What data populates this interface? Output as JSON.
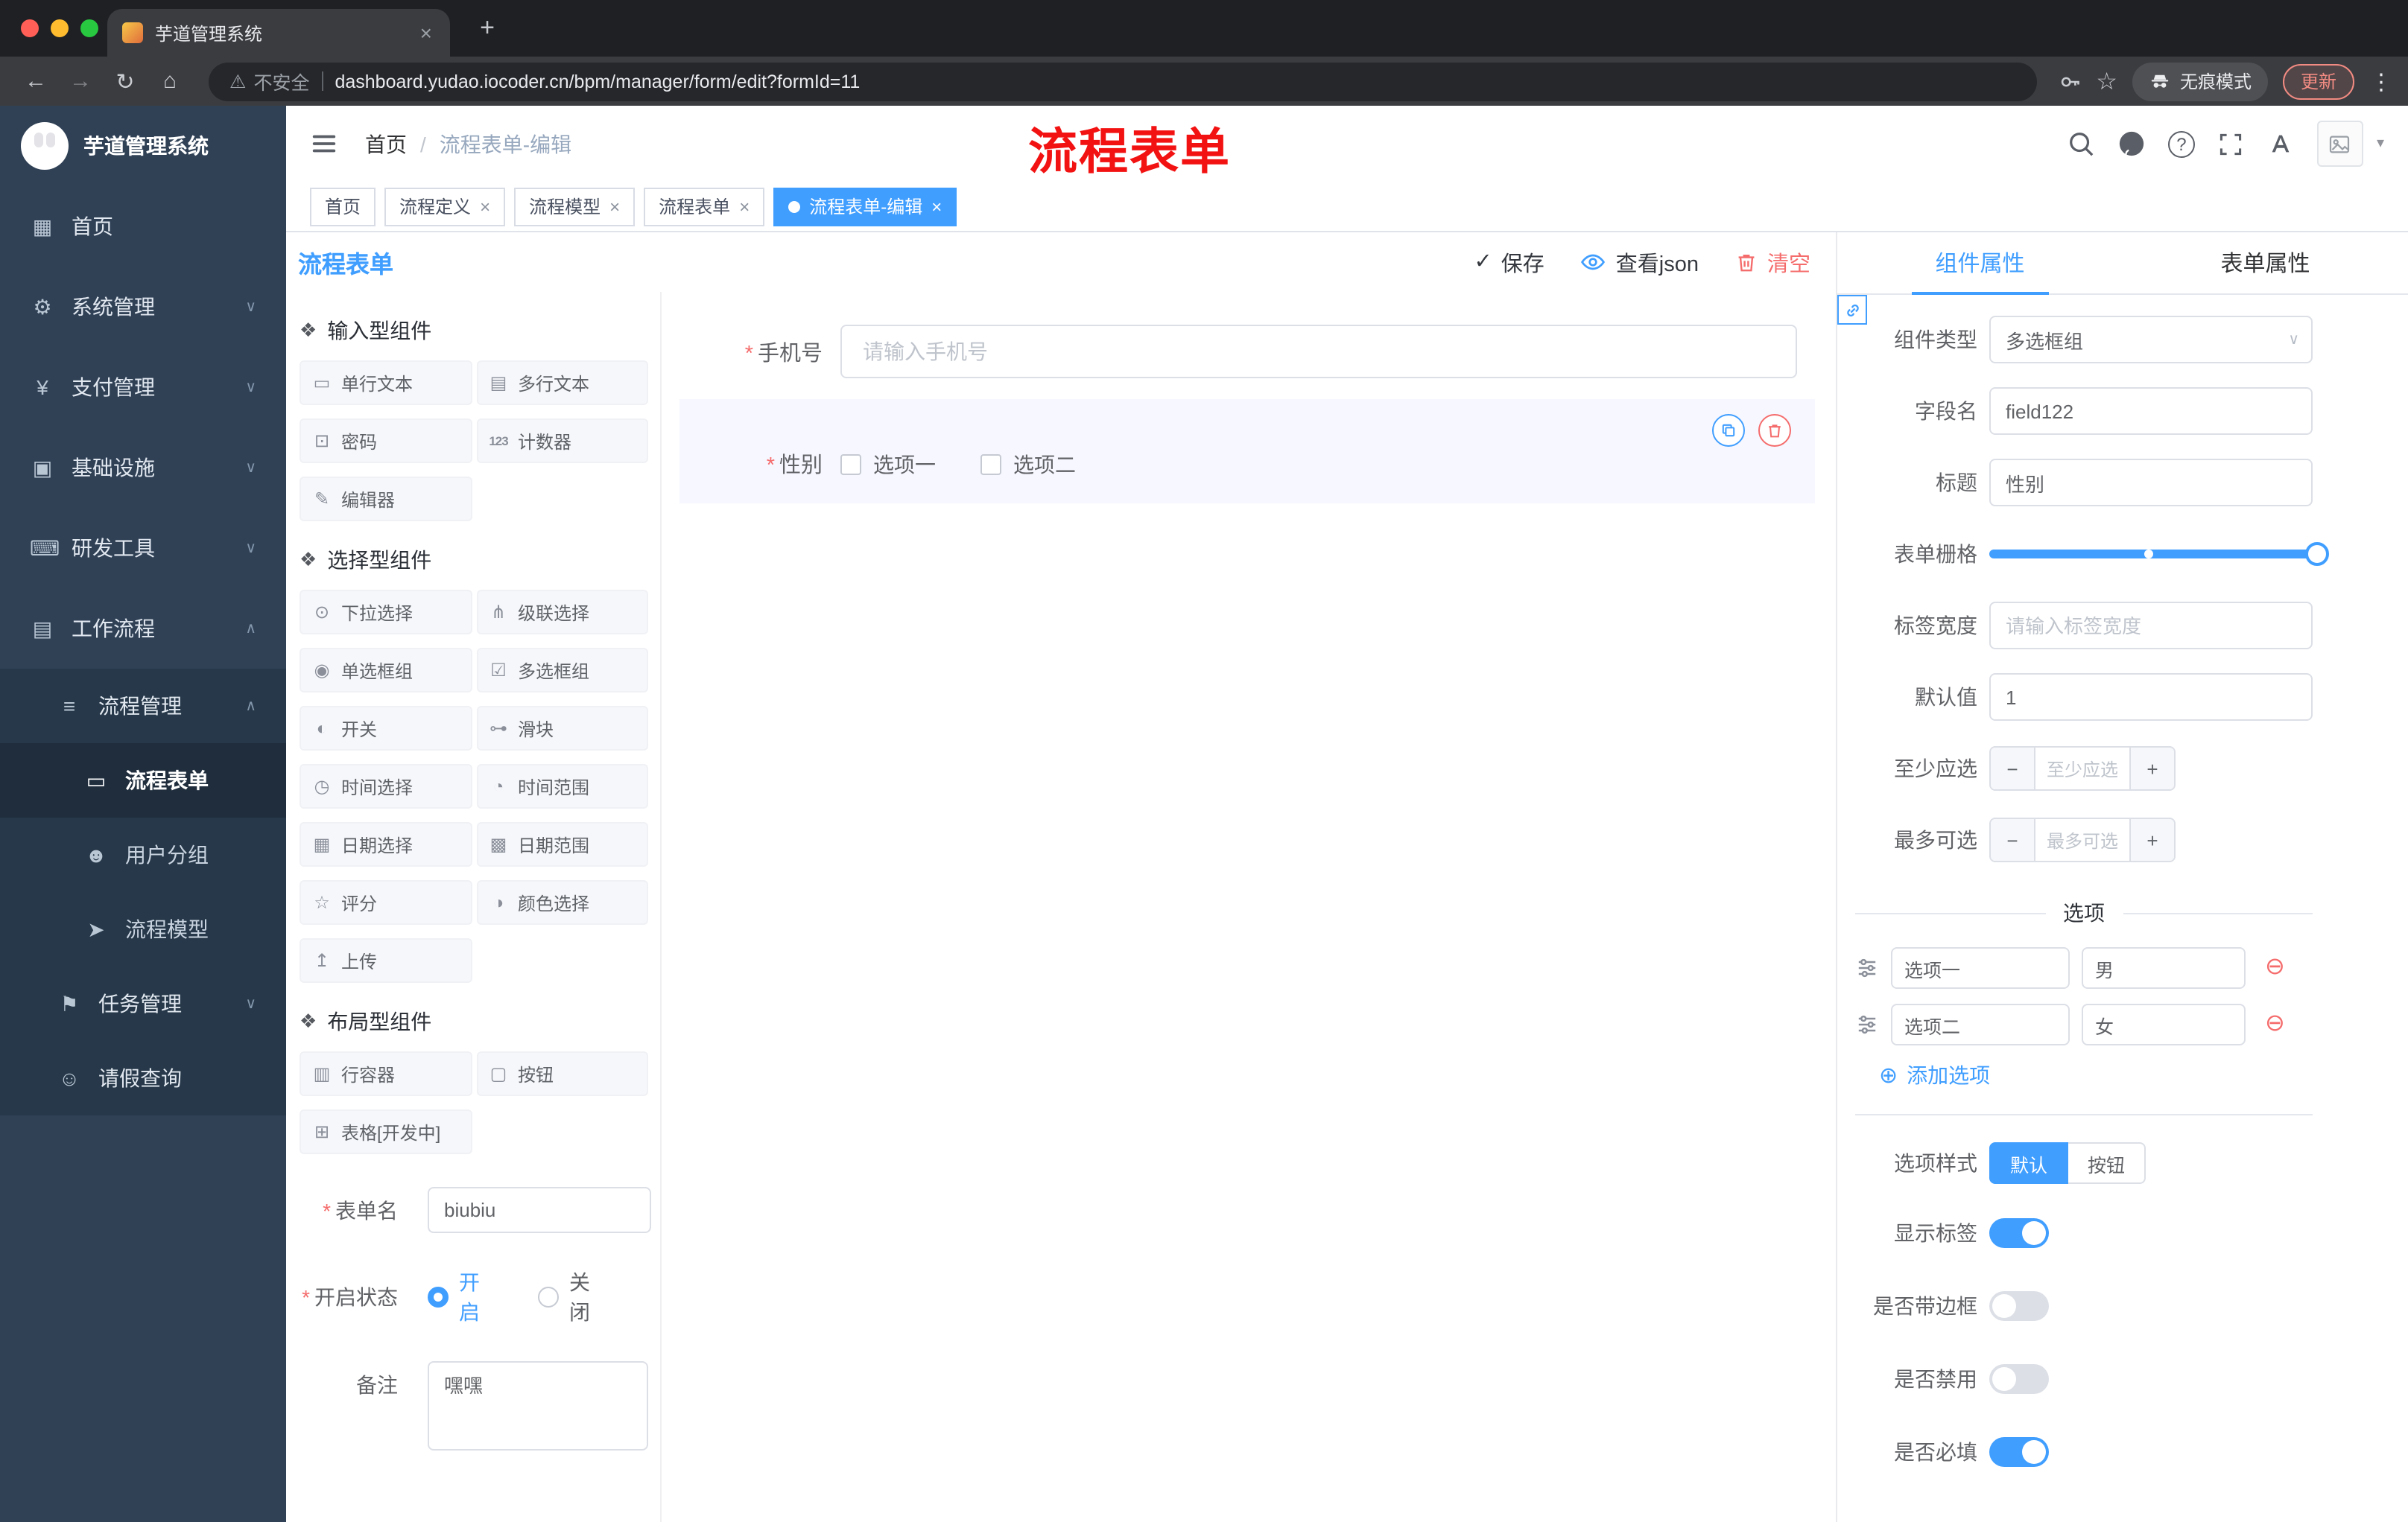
{
  "icons": {
    "back": "←",
    "forward": "→",
    "reload": "↻",
    "home": "⌂",
    "warning": "⚠",
    "pipe": "|",
    "star": "☆",
    "kebab": "⋮",
    "plus": "+",
    "close": "×",
    "question": "?",
    "caret": "▾",
    "check": "✓",
    "minus_circle": "⊖",
    "plus_circle": "⊕",
    "chevron_down": "∨",
    "chevron_up": "∧",
    "asterisk": "*",
    "section": "❖",
    "minus": "−"
  },
  "colors": {
    "primary": "#409eff",
    "danger": "#f56c6c",
    "active_tag": "#409eff"
  },
  "browser": {
    "tab_title": "芋道管理系统",
    "security_label": "不安全",
    "url": "dashboard.yudao.iocoder.cn/bpm/manager/form/edit?formId=11",
    "incognito_label": "无痕模式",
    "update_label": "更新"
  },
  "sidebar": {
    "logo_title": "芋道管理系统",
    "top_items": [
      {
        "label": "首页",
        "icon": "▦",
        "chevron": ""
      },
      {
        "label": "系统管理",
        "icon": "⚙",
        "chevron": "∨"
      },
      {
        "label": "支付管理",
        "icon": "¥",
        "chevron": "∨"
      },
      {
        "label": "基础设施",
        "icon": "▣",
        "chevron": "∨"
      },
      {
        "label": "研发工具",
        "icon": "⌨",
        "chevron": "∨"
      },
      {
        "label": "工作流程",
        "icon": "▤",
        "chevron": "∧"
      }
    ],
    "sub": {
      "manage": {
        "label": "流程管理",
        "icon": "≡",
        "chevron": "∧"
      },
      "leaves": [
        {
          "label": "流程表单",
          "icon": "▭",
          "active": true
        },
        {
          "label": "用户分组",
          "icon": "☻",
          "active": false
        },
        {
          "label": "流程模型",
          "icon": "➤",
          "active": false
        }
      ],
      "task": {
        "label": "任务管理",
        "icon": "⚑",
        "chevron": "∨"
      },
      "leave": {
        "label": "请假查询",
        "icon": "☺"
      }
    }
  },
  "header": {
    "breadcrumb": [
      "首页",
      "流程表单-编辑"
    ],
    "annotation": "流程表单"
  },
  "tags": [
    {
      "label": "首页",
      "closable": false,
      "active": false
    },
    {
      "label": "流程定义",
      "closable": true,
      "active": false
    },
    {
      "label": "流程模型",
      "closable": true,
      "active": false
    },
    {
      "label": "流程表单",
      "closable": true,
      "active": false
    },
    {
      "label": "流程表单-编辑",
      "closable": true,
      "active": true
    }
  ],
  "designer": {
    "title": "流程表单",
    "toolbar": {
      "save": "保存",
      "view_json": "查看json",
      "clear": "清空"
    },
    "palette": {
      "sections": [
        {
          "title": "输入型组件",
          "items": [
            {
              "label": "单行文本",
              "icon": "▭"
            },
            {
              "label": "多行文本",
              "icon": "▤"
            },
            {
              "label": "密码",
              "icon": "⊡"
            },
            {
              "label": "计数器",
              "icon": "123"
            },
            {
              "label": "编辑器",
              "icon": "✎"
            }
          ]
        },
        {
          "title": "选择型组件",
          "items": [
            {
              "label": "下拉选择",
              "icon": "⊙"
            },
            {
              "label": "级联选择",
              "icon": "⋔"
            },
            {
              "label": "单选框组",
              "icon": "◉"
            },
            {
              "label": "多选框组",
              "icon": "☑"
            },
            {
              "label": "开关",
              "icon": "◐"
            },
            {
              "label": "滑块",
              "icon": "⊶"
            },
            {
              "label": "时间选择",
              "icon": "◷"
            },
            {
              "label": "时间范围",
              "icon": "◔"
            },
            {
              "label": "日期选择",
              "icon": "▦"
            },
            {
              "label": "日期范围",
              "icon": "▩"
            },
            {
              "label": "评分",
              "icon": "☆"
            },
            {
              "label": "颜色选择",
              "icon": "◑"
            },
            {
              "label": "上传",
              "icon": "↥"
            }
          ]
        },
        {
          "title": "布局型组件",
          "items": [
            {
              "label": "行容器",
              "icon": "▥"
            },
            {
              "label": "按钮",
              "icon": "▢"
            },
            {
              "label": "表格[开发中]",
              "icon": "⊞"
            }
          ]
        }
      ]
    },
    "meta_form": {
      "name_label": "表单名",
      "name_value": "biubiu",
      "status_label": "开启状态",
      "status_on": "开启",
      "status_off": "关闭",
      "status_selected": "开启",
      "remark_label": "备注",
      "remark_value": "嘿嘿"
    },
    "canvas": {
      "phone_label": "手机号",
      "phone_placeholder": "请输入手机号",
      "gender_label": "性别",
      "gender_options": [
        {
          "label": "选项一",
          "checked": false
        },
        {
          "label": "选项二",
          "checked": false
        }
      ]
    }
  },
  "props_panel": {
    "tabs": [
      {
        "label": "组件属性",
        "active": true
      },
      {
        "label": "表单属性",
        "active": false
      }
    ],
    "fields": {
      "type_label": "组件类型",
      "type_value": "多选框组",
      "field_label": "字段名",
      "field_value": "field122",
      "title_label": "标题",
      "title_value": "性别",
      "grid_label": "表单栅格",
      "label_width_label": "标签宽度",
      "label_width_placeholder": "请输入标签宽度",
      "default_label": "默认值",
      "default_value": "1",
      "min_label": "至少应选",
      "min_placeholder": "至少应选",
      "max_label": "最多可选",
      "max_placeholder": "最多可选"
    },
    "options": {
      "divider": "选项",
      "rows": [
        {
          "label": "选项一",
          "value": "男"
        },
        {
          "label": "选项二",
          "value": "女"
        }
      ],
      "add": "添加选项"
    },
    "style": {
      "label": "选项样式",
      "default_btn": "默认",
      "button_btn": "按钮",
      "selected": "默认"
    },
    "switches": [
      {
        "label": "显示标签",
        "on": true
      },
      {
        "label": "是否带边框",
        "on": false
      },
      {
        "label": "是否禁用",
        "on": false
      },
      {
        "label": "是否必填",
        "on": true
      }
    ]
  }
}
